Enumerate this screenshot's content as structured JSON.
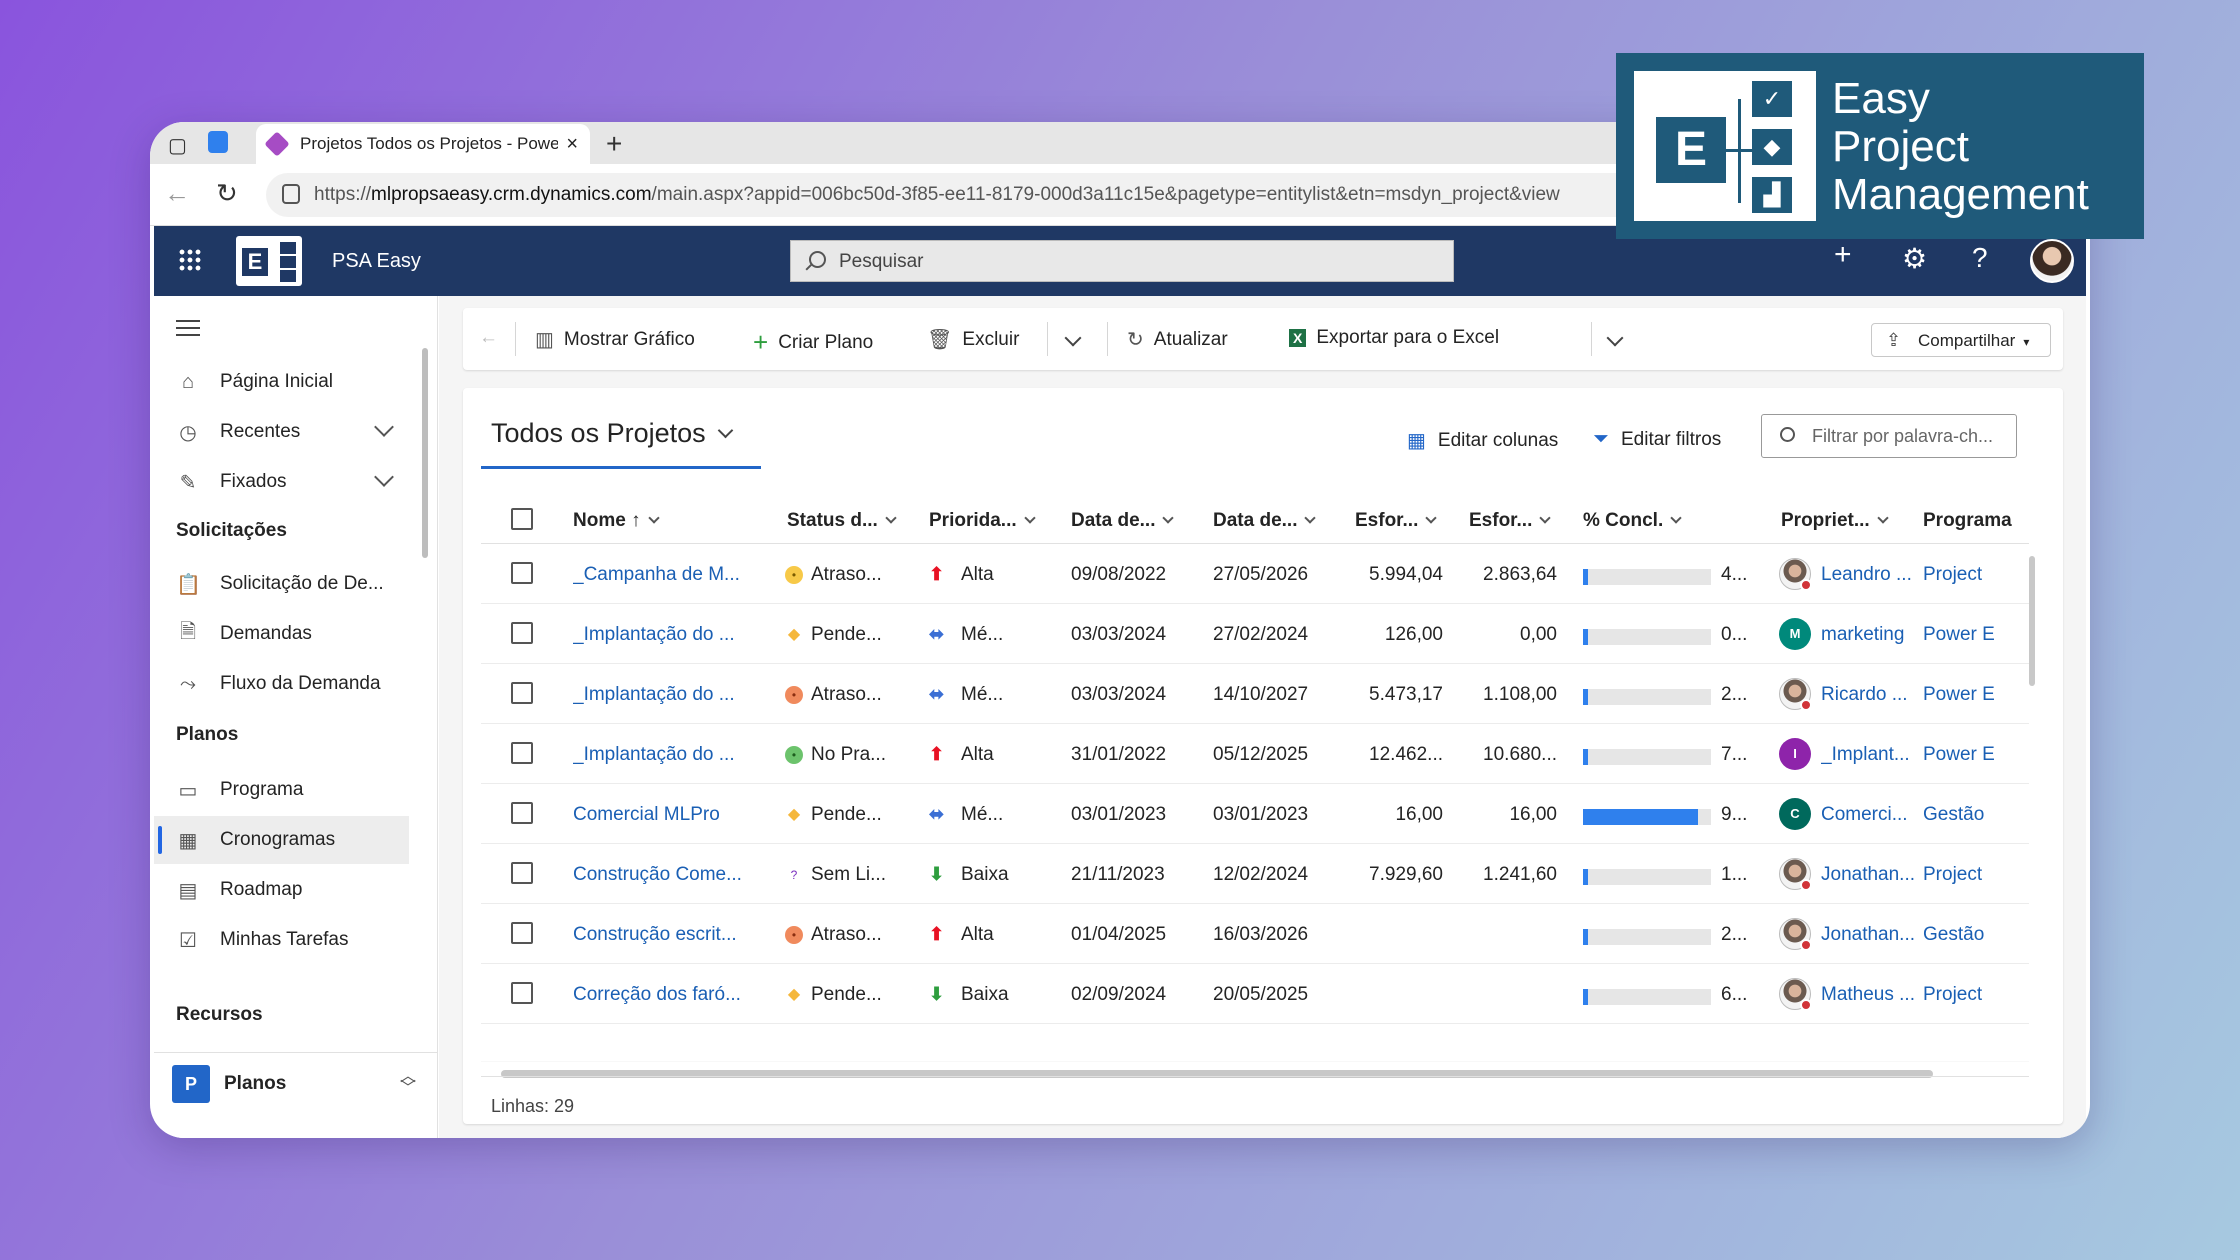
{
  "browser": {
    "tab_title": "Projetos Todos os Projetos - Power Apps",
    "url_prefix": "https://",
    "url_host": "mlpropsaeasy.crm.dynamics.com",
    "url_rest": "/main.aspx?appid=006bc50d-3f85-ee11-8179-000d3a11c15e&pagetype=entitylist&etn=msdyn_project&view"
  },
  "header": {
    "app_name": "PSA Easy",
    "search_placeholder": "Pesquisar"
  },
  "sidebar": {
    "items": [
      {
        "label": "Página Inicial",
        "icon": "home-icon"
      },
      {
        "label": "Recentes",
        "icon": "clock-icon"
      },
      {
        "label": "Fixados",
        "icon": "pin-icon"
      }
    ],
    "sections": [
      {
        "title": "Solicitações",
        "items": [
          {
            "label": "Solicitação de De...",
            "icon": "clipboard-icon"
          },
          {
            "label": "Demandas",
            "icon": "document-icon"
          },
          {
            "label": "Fluxo da Demanda",
            "icon": "flow-icon"
          }
        ]
      },
      {
        "title": "Planos",
        "items": [
          {
            "label": "Programa",
            "icon": "program-icon"
          },
          {
            "label": "Cronogramas",
            "icon": "schedule-icon"
          },
          {
            "label": "Roadmap",
            "icon": "calendar-icon"
          },
          {
            "label": "Minhas Tarefas",
            "icon": "tasks-icon"
          }
        ]
      },
      {
        "title": "Recursos",
        "items": []
      }
    ],
    "area": {
      "letter": "P",
      "label": "Planos"
    }
  },
  "commands": {
    "show_chart": "Mostrar Gráfico",
    "create_plan": "Criar Plano",
    "delete": "Excluir",
    "refresh": "Atualizar",
    "export_excel": "Exportar para o Excel",
    "share": "Compartilhar"
  },
  "grid": {
    "view_title": "Todos os Projetos",
    "edit_columns": "Editar colunas",
    "edit_filters": "Editar filtros",
    "filter_placeholder": "Filtrar por palavra-ch...",
    "columns": [
      "Nome ↑",
      "Status d...",
      "Priorida...",
      "Data de...",
      "Data de...",
      "Esfor...",
      "Esfor...",
      "% Concl.",
      "Propriet...",
      "Programa"
    ],
    "rows": [
      {
        "name": "_Campanha de M...",
        "status": "Atraso...",
        "status_icon": "neutral",
        "priority": "Alta",
        "start": "09/08/2022",
        "finish": "27/05/2026",
        "effort1": "5.994,04",
        "effort2": "2.863,64",
        "pct": "4...",
        "pct_value": 0.04,
        "owner": "Leandro ...",
        "owner_type": "photo",
        "owner_letter": "",
        "owner_color": "",
        "program": "Project"
      },
      {
        "name": "_Implantação do ...",
        "status": "Pende...",
        "status_icon": "pending",
        "priority": "Mé...",
        "start": "03/03/2024",
        "finish": "27/02/2024",
        "effort1": "126,00",
        "effort2": "0,00",
        "pct": "0...",
        "pct_value": 0.0,
        "owner": "marketing",
        "owner_type": "letter",
        "owner_letter": "M",
        "owner_color": "#00897b",
        "program": "Power E"
      },
      {
        "name": "_Implantação do ...",
        "status": "Atraso...",
        "status_icon": "late",
        "priority": "Mé...",
        "start": "03/03/2024",
        "finish": "14/10/2027",
        "effort1": "5.473,17",
        "effort2": "1.108,00",
        "pct": "2...",
        "pct_value": 0.02,
        "owner": "Ricardo ...",
        "owner_type": "photo",
        "owner_letter": "",
        "owner_color": "",
        "program": "Power E"
      },
      {
        "name": "_Implantação do ...",
        "status": "No Pra...",
        "status_icon": "ontime",
        "priority": "Alta",
        "start": "31/01/2022",
        "finish": "05/12/2025",
        "effort1": "12.462...",
        "effort2": "10.680...",
        "pct": "7...",
        "pct_value": 0.03,
        "owner": "_Implant...",
        "owner_type": "letter",
        "owner_letter": "I",
        "owner_color": "#8e24aa",
        "program": "Power E"
      },
      {
        "name": "Comercial MLPro",
        "status": "Pende...",
        "status_icon": "pending",
        "priority": "Mé...",
        "start": "03/01/2023",
        "finish": "03/01/2023",
        "effort1": "16,00",
        "effort2": "16,00",
        "pct": "9...",
        "pct_value": 0.9,
        "owner": "Comerci...",
        "owner_type": "letter",
        "owner_letter": "C",
        "owner_color": "#00695c",
        "program": "Gestão"
      },
      {
        "name": "Construção Come...",
        "status": "Sem Li...",
        "status_icon": "unknown",
        "priority": "Baixa",
        "start": "21/11/2023",
        "finish": "12/02/2024",
        "effort1": "7.929,60",
        "effort2": "1.241,60",
        "pct": "1...",
        "pct_value": 0.03,
        "owner": "Jonathan...",
        "owner_type": "photo",
        "owner_letter": "",
        "owner_color": "",
        "program": "Project"
      },
      {
        "name": "Construção escrit...",
        "status": "Atraso...",
        "status_icon": "late",
        "priority": "Alta",
        "start": "01/04/2025",
        "finish": "16/03/2026",
        "effort1": "",
        "effort2": "",
        "pct": "2...",
        "pct_value": 0.03,
        "owner": "Jonathan...",
        "owner_type": "photo",
        "owner_letter": "",
        "owner_color": "",
        "program": "Gestão"
      },
      {
        "name": "Correção dos faró...",
        "status": "Pende...",
        "status_icon": "pending",
        "priority": "Baixa",
        "start": "02/09/2024",
        "finish": "20/05/2025",
        "effort1": "",
        "effort2": "",
        "pct": "6...",
        "pct_value": 0.03,
        "owner": "Matheus ...",
        "owner_type": "photo",
        "owner_letter": "",
        "owner_color": "",
        "program": "Project"
      }
    ],
    "row_count": "Linhas: 29"
  },
  "brand": {
    "line1": "Easy",
    "line2": "Project",
    "line3": "Management",
    "logo_letter": "E"
  },
  "colors": {
    "header_bg": "#1f3864",
    "brand_bg": "#1f5a7a",
    "link": "#1a5fb4",
    "accent": "#2266c8",
    "progress": "#2f80ed",
    "priority_high": "#e81123",
    "priority_medium": "#3b6fd4",
    "priority_low": "#2e9e3e"
  }
}
